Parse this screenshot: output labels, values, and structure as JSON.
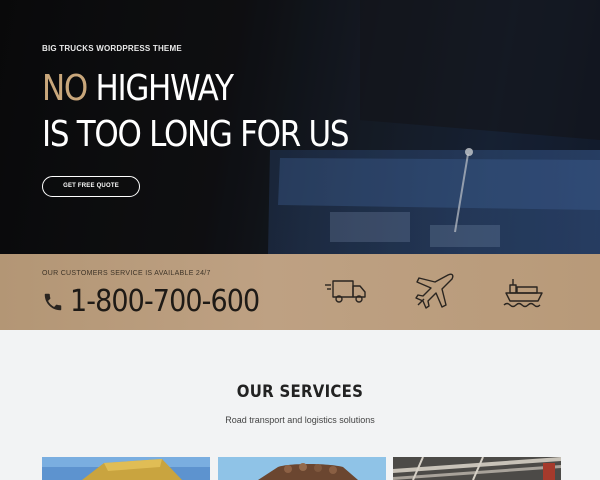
{
  "hero": {
    "eyebrow": "BIG TRUCKS WORDPRESS THEME",
    "headline_accent": "NO",
    "headline_rest_line1": "HIGHWAY",
    "headline_line2": "IS TOO LONG FOR US",
    "cta_label": "GET FREE QUOTE"
  },
  "contact": {
    "label": "OUR CUSTOMERS SERVICE IS AVAILABLE 24/7",
    "phone": "1-800-700-600",
    "phone_icon": "phone-icon",
    "service_icons": [
      "delivery-truck-icon",
      "airplane-icon",
      "cargo-ship-icon"
    ]
  },
  "services": {
    "title": "OUR SERVICES",
    "subtitle": "Road transport and logistics solutions"
  },
  "colors": {
    "accent": "#c9a77b",
    "strip": "#b89a79",
    "hero_dark": "#0b0b0c",
    "page_bg": "#f2f3f4"
  }
}
